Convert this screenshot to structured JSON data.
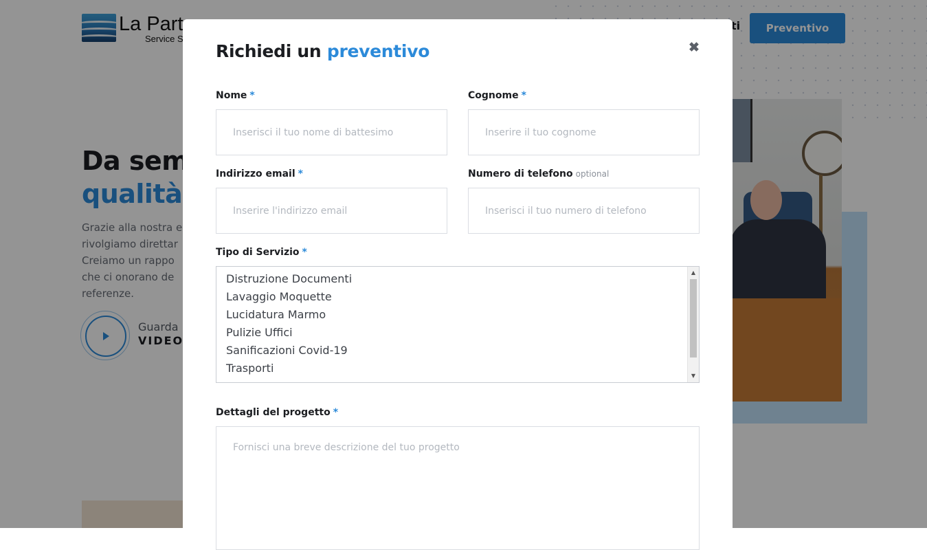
{
  "background": {
    "logo_name": "La Parte",
    "logo_sub": "Service S",
    "nav_fragment": "ti",
    "cta_label": "Preventivo",
    "hero_title_line1": "Da sem",
    "hero_title_line2": "qualità",
    "hero_text": "Grazie alla nostra e\nrivolgiamo direttar\nCreiamo un rappo\nche ci onorano de\nreferenze.",
    "video_line1": "Guarda",
    "video_line2": "VIDEO I"
  },
  "modal": {
    "title_prefix": "Richiedi un",
    "title_accent": "preventivo",
    "close_symbol": "✖",
    "required_mark": "*",
    "fields": {
      "first_name": {
        "label": "Nome",
        "placeholder": "Inserisci il tuo nome di battesimo",
        "value": ""
      },
      "last_name": {
        "label": "Cognome",
        "placeholder": "Inserire il tuo cognome",
        "value": ""
      },
      "email": {
        "label": "Indirizzo email",
        "placeholder": "Inserire l'indirizzo email",
        "value": ""
      },
      "phone": {
        "label": "Numero di telefono",
        "optional_note": "optional",
        "placeholder": "Inserisci il tuo numero di telefono",
        "value": ""
      },
      "service": {
        "label": "Tipo di Servizio",
        "options": [
          "Distruzione Documenti",
          "Lavaggio Moquette",
          "Lucidatura Marmo",
          "Pulizie Uffici",
          "Sanificazioni Covid-19",
          "Trasporti"
        ]
      },
      "details": {
        "label": "Dettagli del progetto",
        "placeholder": "Fornisci una breve descrizione del tuo progetto",
        "value": ""
      }
    }
  },
  "colors": {
    "accent": "#2c8ad9",
    "overlay": "rgba(0,0,0,0.42)",
    "text": "#1b1d21"
  }
}
